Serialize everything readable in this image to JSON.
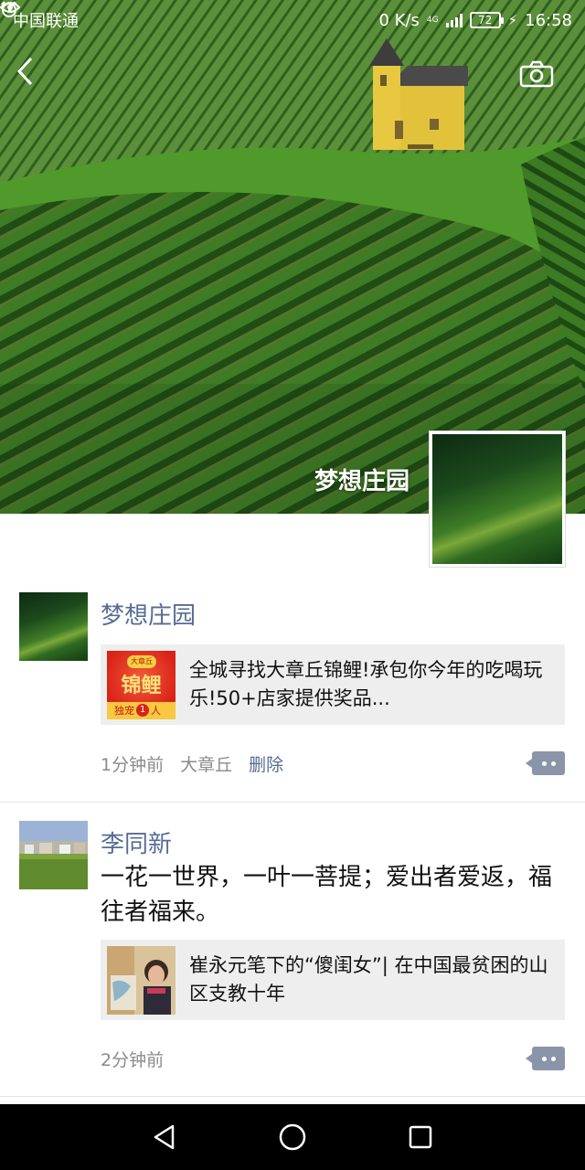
{
  "status_bar": {
    "carrier": "中国联通",
    "net_speed": "0 K/s",
    "network": "4G",
    "battery": "72",
    "time": "16:58"
  },
  "header": {
    "back_icon": "chevron-left-icon",
    "camera_icon": "camera-icon"
  },
  "profile": {
    "name": "梦想庄园"
  },
  "posts": [
    {
      "author": "梦想庄园",
      "link": {
        "thumb_top": "大章丘",
        "thumb_main": "锦鲤",
        "thumb_bottom": "独宠",
        "thumb_badge": "1",
        "thumb_suffix": "人",
        "title": "全城寻找大章丘锦鲤!承包你今年的吃喝玩乐!50+店家提供奖品..."
      },
      "time": "1分钟前",
      "location": "大章丘",
      "delete_label": "删除"
    },
    {
      "author": "李同新",
      "text": "一花一世界，一叶一菩提；爱出者爱返，福往者福来。",
      "link": {
        "title": "崔永元笔下的“傻闺女”| 在中国最贫困的山区支教十年"
      },
      "time": "2分钟前"
    }
  ],
  "navbar": {
    "back_icon": "triangle-back-icon",
    "home_icon": "circle-home-icon",
    "recents_icon": "square-recents-icon"
  },
  "colors": {
    "link_blue": "#576b95",
    "card_bg": "#eeeeee",
    "meta_gray": "#8a8a8a"
  }
}
